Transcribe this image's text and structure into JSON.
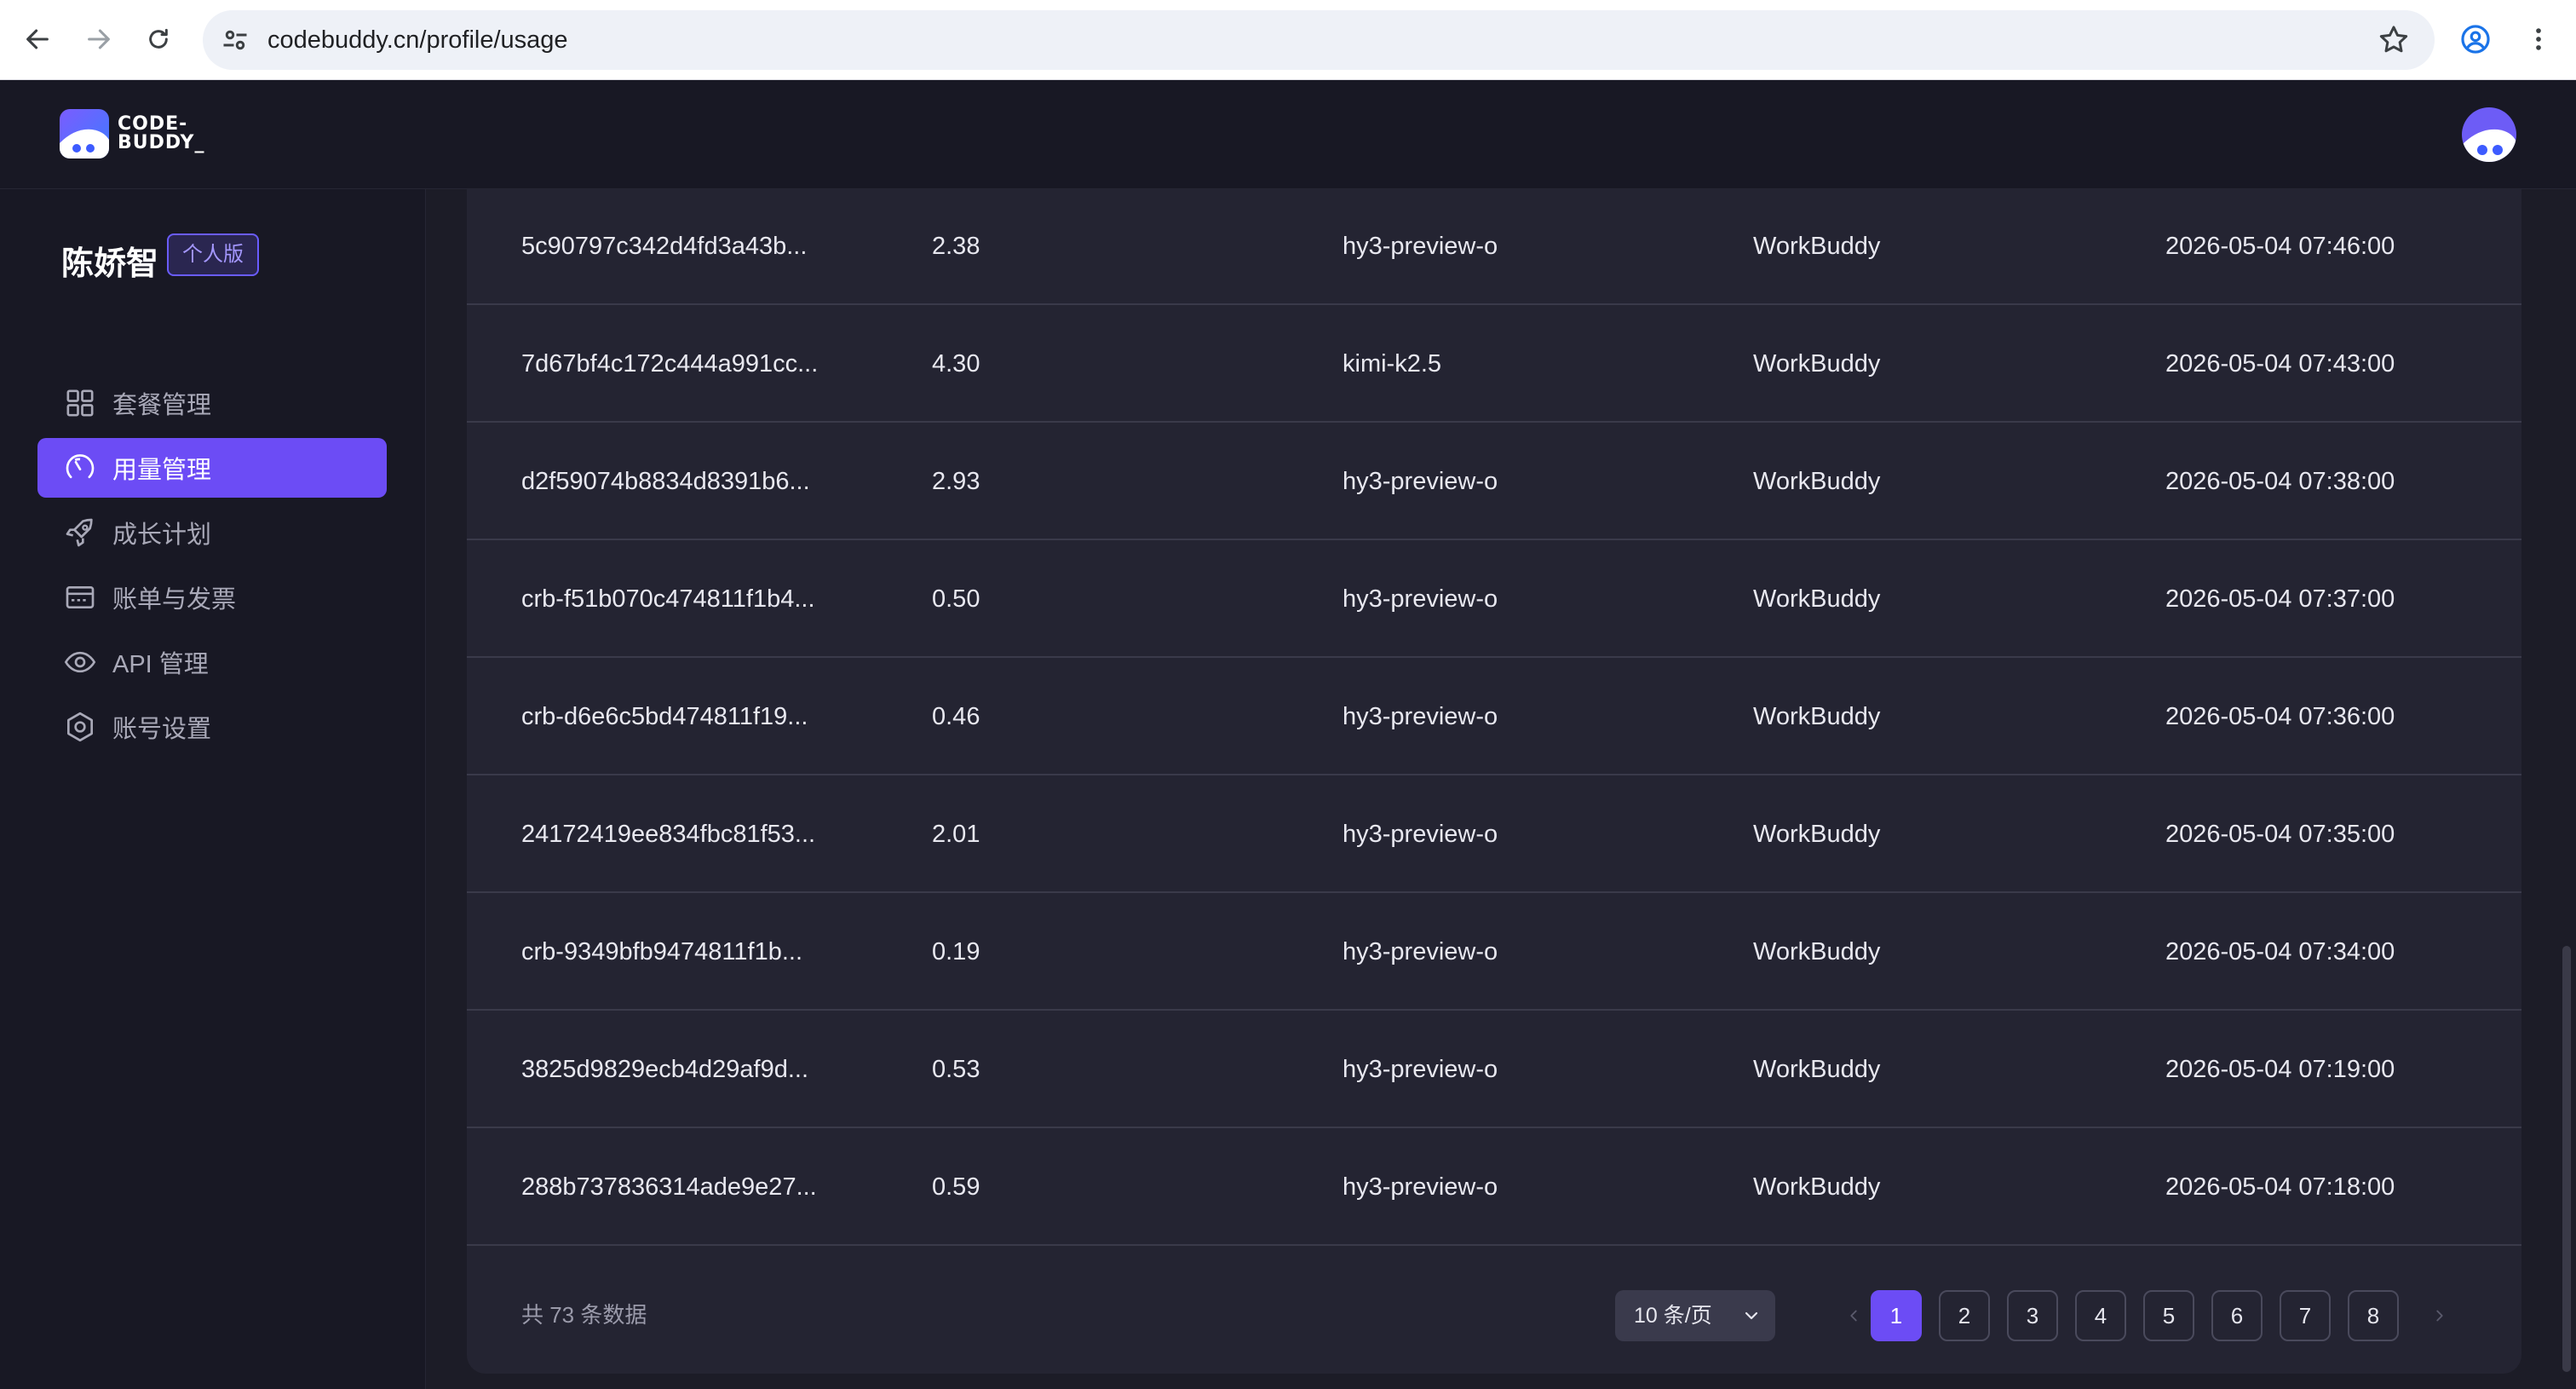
{
  "browser": {
    "url": "codebuddy.cn/profile/usage"
  },
  "app": {
    "logo_text_line1": "CODE-",
    "logo_text_line2": "BUDDY_"
  },
  "sidebar": {
    "user_name": "陈娇智",
    "plan_badge": "个人版",
    "items": [
      {
        "label": "套餐管理",
        "icon": "grid-icon",
        "active": false
      },
      {
        "label": "用量管理",
        "icon": "gauge-icon",
        "active": true
      },
      {
        "label": "成长计划",
        "icon": "rocket-icon",
        "active": false
      },
      {
        "label": "账单与发票",
        "icon": "invoice-icon",
        "active": false
      },
      {
        "label": "API 管理",
        "icon": "eye-icon",
        "active": false
      },
      {
        "label": "账号设置",
        "icon": "hexagon-settings-icon",
        "active": false
      }
    ]
  },
  "table": {
    "rows": [
      {
        "id": "5c90797c342d4fd3a43b...",
        "credits": "2.38",
        "model": "hy3-preview-o",
        "product": "WorkBuddy",
        "time": "2026-05-04 07:46:00"
      },
      {
        "id": "7d67bf4c172c444a991cc...",
        "credits": "4.30",
        "model": "kimi-k2.5",
        "product": "WorkBuddy",
        "time": "2026-05-04 07:43:00"
      },
      {
        "id": "d2f59074b8834d8391b6...",
        "credits": "2.93",
        "model": "hy3-preview-o",
        "product": "WorkBuddy",
        "time": "2026-05-04 07:38:00"
      },
      {
        "id": "crb-f51b070c474811f1b4...",
        "credits": "0.50",
        "model": "hy3-preview-o",
        "product": "WorkBuddy",
        "time": "2026-05-04 07:37:00"
      },
      {
        "id": "crb-d6e6c5bd474811f19...",
        "credits": "0.46",
        "model": "hy3-preview-o",
        "product": "WorkBuddy",
        "time": "2026-05-04 07:36:00"
      },
      {
        "id": "24172419ee834fbc81f53...",
        "credits": "2.01",
        "model": "hy3-preview-o",
        "product": "WorkBuddy",
        "time": "2026-05-04 07:35:00"
      },
      {
        "id": "crb-9349bfb9474811f1b...",
        "credits": "0.19",
        "model": "hy3-preview-o",
        "product": "WorkBuddy",
        "time": "2026-05-04 07:34:00"
      },
      {
        "id": "3825d9829ecb4d29af9d...",
        "credits": "0.53",
        "model": "hy3-preview-o",
        "product": "WorkBuddy",
        "time": "2026-05-04 07:19:00"
      },
      {
        "id": "288b737836314ade9e27...",
        "credits": "0.59",
        "model": "hy3-preview-o",
        "product": "WorkBuddy",
        "time": "2026-05-04 07:18:00"
      }
    ]
  },
  "pagination": {
    "total_text": "共 73 条数据",
    "page_size": "10 条/页",
    "pages": [
      "1",
      "2",
      "3",
      "4",
      "5",
      "6",
      "7",
      "8"
    ],
    "current_page": "1"
  },
  "colors": {
    "accent": "#6c4cf5",
    "background": "#1c1c27",
    "panel": "#242432"
  }
}
